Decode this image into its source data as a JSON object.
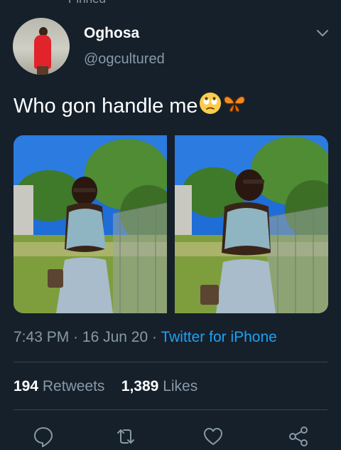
{
  "header": {
    "cut_label": "Pinned"
  },
  "author": {
    "name": "Oghosa",
    "handle": "@ogcultured"
  },
  "tweet": {
    "text": "Who gon handle me",
    "emojis": [
      "rolling-eyes-emoji",
      "butterfly-emoji"
    ]
  },
  "meta": {
    "time": "7:43 PM",
    "sep1": " · ",
    "date": "16 Jun 20",
    "sep2": " · ",
    "source": "Twitter for iPhone"
  },
  "stats": {
    "retweets_count": "194",
    "retweets_label": "Retweets",
    "likes_count": "1,389",
    "likes_label": "Likes"
  },
  "actions": [
    "reply-icon",
    "retweet-icon",
    "like-icon",
    "share-icon"
  ],
  "colors": {
    "background": "#15202b",
    "text": "#ffffff",
    "secondary": "#8899a6",
    "link": "#1da1f2",
    "divider": "#38444d"
  }
}
